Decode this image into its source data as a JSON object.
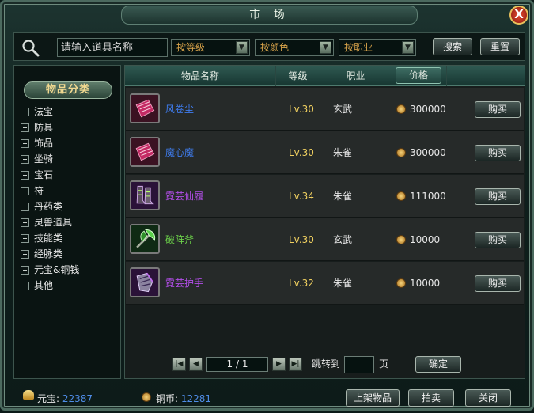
{
  "window": {
    "title": "市 场",
    "close_label": "X"
  },
  "search": {
    "placeholder": "请输入道具名称",
    "filters": [
      {
        "label": "按等级"
      },
      {
        "label": "按颜色"
      },
      {
        "label": "按职业"
      }
    ],
    "search_label": "搜索",
    "reset_label": "重置"
  },
  "sidebar": {
    "header": "物品分类",
    "items": [
      {
        "label": "法宝"
      },
      {
        "label": "防具"
      },
      {
        "label": "饰品"
      },
      {
        "label": "坐骑"
      },
      {
        "label": "宝石"
      },
      {
        "label": "符"
      },
      {
        "label": "丹药类"
      },
      {
        "label": "灵兽道具"
      },
      {
        "label": "技能类"
      },
      {
        "label": "经脉类"
      },
      {
        "label": "元宝&铜钱"
      },
      {
        "label": "其他"
      }
    ]
  },
  "table": {
    "columns": {
      "name": "物品名称",
      "level": "等级",
      "class": "职业",
      "price": "价格"
    },
    "rows": [
      {
        "name": "风卷尘",
        "level": "Lv.30",
        "class": "玄武",
        "price": "300000",
        "buy": "购买",
        "color": "#3f7df0",
        "icon": "tome-icon"
      },
      {
        "name": "魔心魔",
        "level": "Lv.30",
        "class": "朱雀",
        "price": "300000",
        "buy": "购买",
        "color": "#3f7df0",
        "icon": "tome-icon"
      },
      {
        "name": "霓芸仙履",
        "level": "Lv.34",
        "class": "朱雀",
        "price": "111000",
        "buy": "购买",
        "color": "#b34ee9",
        "icon": "boots-icon"
      },
      {
        "name": "破阵斧",
        "level": "Lv.30",
        "class": "玄武",
        "price": "10000",
        "buy": "购买",
        "color": "#6bd049",
        "icon": "axe-icon"
      },
      {
        "name": "霓芸护手",
        "level": "Lv.32",
        "class": "朱雀",
        "price": "10000",
        "buy": "购买",
        "color": "#b34ee9",
        "icon": "gauntlet-icon"
      }
    ]
  },
  "pager": {
    "page_text": "1 / 1",
    "jump_label": "跳转到",
    "page_unit": "页",
    "confirm_label": "确定"
  },
  "footer": {
    "yuanbao_label": "元宝:",
    "yuanbao_value": "22387",
    "copper_label": "铜币:",
    "copper_value": "12281",
    "list_item_label": "上架物品",
    "auction_label": "拍卖",
    "close_label": "关闭"
  }
}
